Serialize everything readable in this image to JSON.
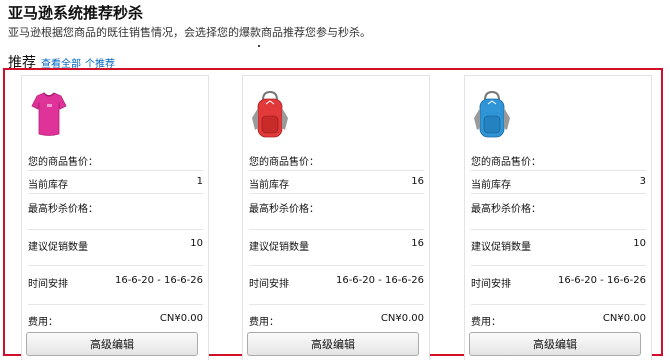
{
  "page": {
    "title": "亚马逊系统推荐秒杀",
    "subtitle": "亚马逊根据您商品的既往销售情况，会选择您的爆款商品推荐您参与秒杀。"
  },
  "recommend": {
    "title": "推荐",
    "view_all": "查看全部",
    "count": "个推荐"
  },
  "labels": {
    "price": "您的商品售价：",
    "stock": "当前库存",
    "max_price": "最高秒杀价格：",
    "promo_qty": "建议促销数量",
    "schedule": "时间安排",
    "fee": "费用："
  },
  "cards": [
    {
      "thumbnail": "pink-tshirt-image",
      "price": "",
      "stock": "1",
      "max_price": "",
      "promo_qty": "10",
      "schedule": "16-6-20 - 16-6-26",
      "fee": "CN¥0.00",
      "button": "高级编辑"
    },
    {
      "thumbnail": "red-backpack-image",
      "price": "",
      "stock": "16",
      "max_price": "",
      "promo_qty": "16",
      "schedule": "16-6-20 - 16-6-26",
      "fee": "CN¥0.00",
      "button": "高级编辑"
    },
    {
      "thumbnail": "blue-backpack-image",
      "price": "",
      "stock": "3",
      "max_price": "",
      "promo_qty": "10",
      "schedule": "16-6-20 - 16-6-26",
      "fee": "CN¥0.00",
      "button": "高级编辑"
    }
  ],
  "colors": {
    "highlight_border": "#d0102a",
    "link": "#0066c0",
    "shirt": "#e0339a",
    "backpack_red": "#e23a3a",
    "backpack_blue": "#2f95d6"
  }
}
